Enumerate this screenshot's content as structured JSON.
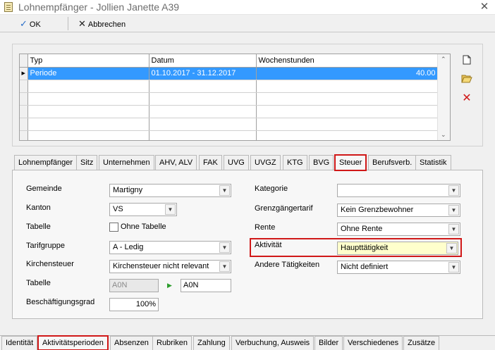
{
  "window": {
    "title": "Lohnempfänger - Jollien Janette A39",
    "close": "✕"
  },
  "toolbar": {
    "ok_label": "OK",
    "cancel_label": "Abbrechen",
    "ok_icon": "✓",
    "cancel_icon": "✕"
  },
  "grid": {
    "columns": [
      "Typ",
      "Datum",
      "Wochenstunden"
    ],
    "rows": [
      {
        "typ": "Periode",
        "datum": "01.10.2017 - 31.12.2017",
        "wochenstunden": "40.00",
        "selected": true
      }
    ]
  },
  "side_icons": {
    "new": "new-document-icon",
    "open": "open-folder-icon",
    "delete": "delete-icon"
  },
  "tabs": [
    "Lohnempfänger",
    "Sitz",
    "Unternehmen",
    "AHV, ALV",
    "FAK",
    "UVG",
    "UVGZ",
    "KTG",
    "BVG",
    "Steuer",
    "Berufsverb.",
    "Statistik"
  ],
  "active_tab": "Steuer",
  "form": {
    "gemeinde": {
      "label": "Gemeinde",
      "value": "Martigny"
    },
    "kanton": {
      "label": "Kanton",
      "value": "VS"
    },
    "tabelle_chk": {
      "label": "Tabelle",
      "checkbox_label": "Ohne Tabelle"
    },
    "tarifgruppe": {
      "label": "Tarifgruppe",
      "value": "A - Ledig"
    },
    "kirchensteuer": {
      "label": "Kirchensteuer",
      "value": "Kirchensteuer nicht relevant"
    },
    "tabelle": {
      "label": "Tabelle",
      "value1": "A0N",
      "value2": "A0N"
    },
    "beschaeftigungsgrad": {
      "label": "Beschäftigungsgrad",
      "value": "100%"
    },
    "kategorie": {
      "label": "Kategorie",
      "value": ""
    },
    "grenzgaengertarif": {
      "label": "Grenzgängertarif",
      "value": "Kein Grenzbewohner"
    },
    "rente": {
      "label": "Rente",
      "value": "Ohne Rente"
    },
    "aktivitaet": {
      "label": "Aktivität",
      "value": "Haupttätigkeit"
    },
    "andere": {
      "label": "Andere Tätigkeiten",
      "value": "Nicht definiert"
    }
  },
  "bottom_tabs": [
    "Identität",
    "Aktivitätsperioden",
    "Absenzen",
    "Rubriken",
    "Zahlung",
    "Verbuchung, Ausweis",
    "Bilder",
    "Verschiedenes",
    "Zusätze"
  ],
  "active_bottom_tab": "Aktivitätsperioden",
  "colors": {
    "selection": "#3399ff",
    "highlight": "#d01818",
    "combo_yellow": "#ffffcc"
  }
}
